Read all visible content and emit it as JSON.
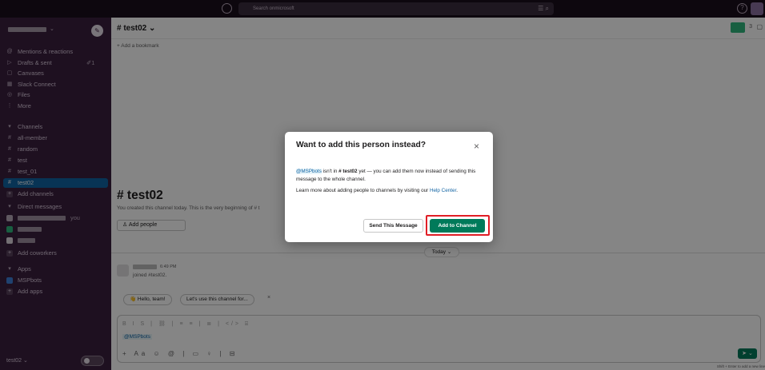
{
  "topbar": {
    "search_placeholder": "Search onmicrosoft"
  },
  "sidebar": {
    "items": [
      {
        "label": "Mentions & reactions",
        "icon": "at-icon"
      },
      {
        "label": "Drafts & sent",
        "icon": "send-icon",
        "count": "1"
      },
      {
        "label": "Canvases",
        "icon": "canvas-icon"
      },
      {
        "label": "Slack Connect",
        "icon": "building-icon"
      },
      {
        "label": "Files",
        "icon": "files-icon"
      },
      {
        "label": "More",
        "icon": "more-icon"
      }
    ],
    "channels_header": "Channels",
    "channels": [
      "all-member",
      "random",
      "test",
      "test_01",
      "test02"
    ],
    "selected_channel": "test02",
    "add_channels": "Add channels",
    "dm_header": "Direct messages",
    "dm_you": "you",
    "add_coworkers": "Add coworkers",
    "apps_header": "Apps",
    "app_item": "MSPbots",
    "add_apps": "Add apps",
    "footer_workspace": "test02"
  },
  "channel": {
    "header_title": "# test02",
    "bookmark": "Add a bookmark",
    "big_title": "# test02",
    "created_text": "You created this channel today. This is the very beginning of # t",
    "add_people": "Add people",
    "today": "Today",
    "message_time": "6:49 PM",
    "message_joined": "joined #test02.",
    "chip1": "Hello, team!",
    "chip2": "Let's use this channel for...",
    "composer_mention": "@MSPbots",
    "hint": "Shift + Enter to add a new line"
  },
  "modal": {
    "title": "Want to add this person instead?",
    "mention": "@MSPbots",
    "body1_a": " isn't in ",
    "body1_ch": "# test02",
    "body1_b": " yet — you can add them now instead of sending this message to the whole channel.",
    "body2": "Learn more about adding people to channels by visiting our ",
    "help_link": "Help Center",
    "body2_end": ".",
    "send_button": "Send This Message",
    "add_button": "Add to Channel"
  },
  "colors": {
    "sidebar_bg": "#3b1f3f",
    "selected": "#1164a3",
    "primary": "#007a5a",
    "highlight_box": "#e01e26"
  }
}
